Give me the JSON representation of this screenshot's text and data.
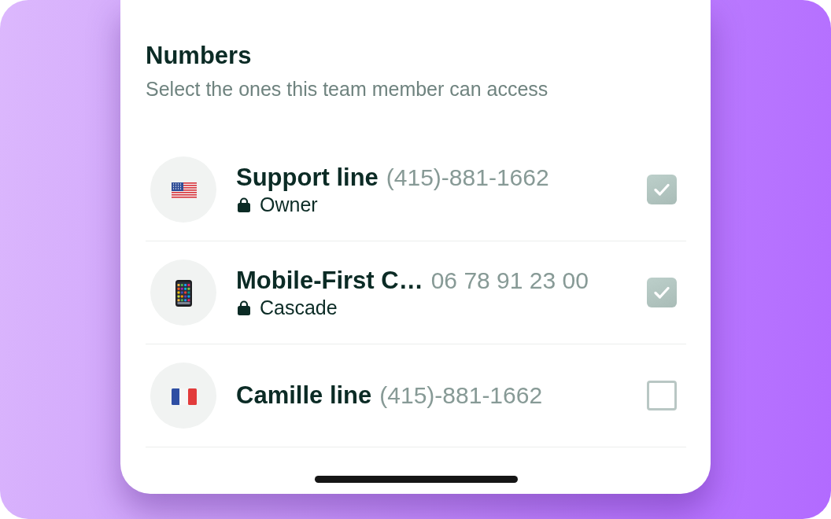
{
  "section": {
    "title": "Numbers",
    "subtitle": "Select the ones this team member can access"
  },
  "numbers": [
    {
      "name": "Support line",
      "phone": "(415)-881-1662",
      "role": "Owner",
      "checked": true
    },
    {
      "name": "Mobile-First C…",
      "phone": "06 78 91 23 00",
      "role": "Cascade",
      "checked": true
    },
    {
      "name": "Camille line",
      "phone": "(415)-881-1662",
      "checked": false
    }
  ]
}
